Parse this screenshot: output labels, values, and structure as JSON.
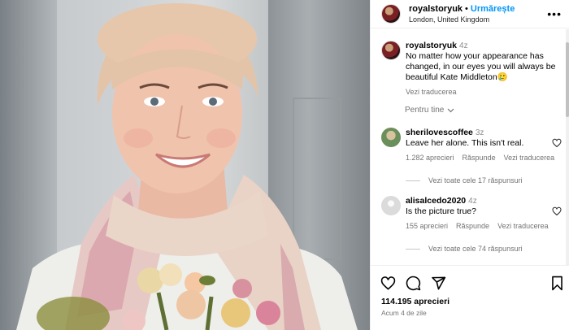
{
  "post": {
    "author": "royalstoryuk",
    "follow_label": "Urmărește",
    "location": "London, United Kingdom"
  },
  "caption": {
    "author": "royalstoryuk",
    "time": "4z",
    "text": "No matter how your appearance has changed, in our eyes you will always be beautiful Kate Middleton",
    "emoji": "🥲",
    "translate_label": "Vezi traducerea"
  },
  "for_you_label": "Pentru tine",
  "comments": [
    {
      "user": "sherilovescoffee",
      "time": "3z",
      "text": "Leave her alone. This isn't real.",
      "likes": "1.282 aprecieri",
      "reply": "Răspunde",
      "translate": "Vezi traducerea",
      "view_replies": "Vezi toate cele 17 răspunsuri",
      "avatar_color": "#6b8f5a"
    },
    {
      "user": "alisalcedo2020",
      "time": "4z",
      "text": "Is the picture true?",
      "likes": "155 aprecieri",
      "reply": "Răspunde",
      "translate": "Vezi traducerea",
      "view_replies": "Vezi toate cele 74 răspunsuri",
      "avatar_color": "#dbdbdb"
    }
  ],
  "footer": {
    "likes": "114.195 aprecieri",
    "ago": "Acum 4 de zile"
  },
  "icons": [
    "heart-icon",
    "comment-icon",
    "share-icon",
    "bookmark-icon",
    "more-icon",
    "chevron-down-icon"
  ],
  "colors": {
    "accent": "#0095f6",
    "muted": "#737373"
  }
}
